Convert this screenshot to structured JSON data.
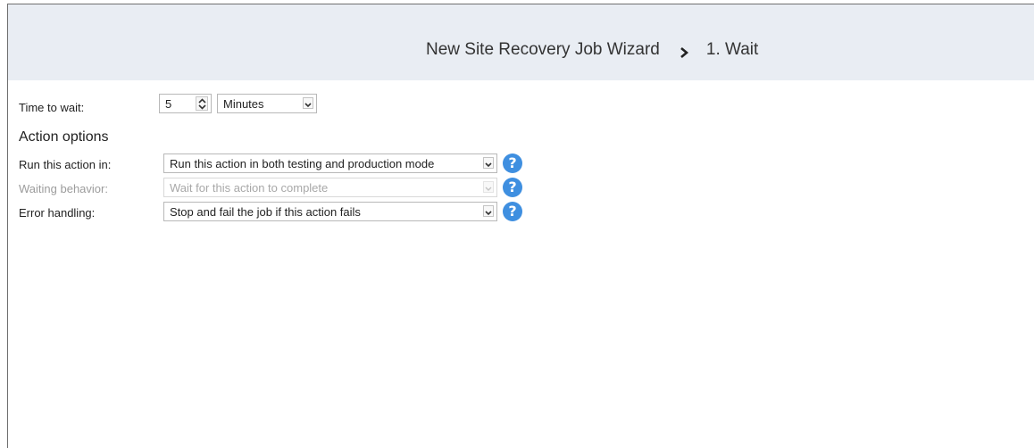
{
  "header": {
    "wizard_title": "New Site Recovery Job Wizard",
    "step": "1. Wait"
  },
  "time_to_wait": {
    "label": "Time to wait:",
    "value": "5",
    "unit": "Minutes"
  },
  "action_options": {
    "title": "Action options",
    "run_in": {
      "label": "Run this action in:",
      "value": "Run this action in both testing and production mode"
    },
    "waiting_behavior": {
      "label": "Waiting behavior:",
      "value": "Wait for this action to complete",
      "disabled": true
    },
    "error_handling": {
      "label": "Error handling:",
      "value": "Stop and fail the job if this action fails"
    },
    "help_glyph": "?"
  },
  "icons": {
    "breadcrumb_separator": "chevron-right-icon",
    "dropdown": "chevron-down-icon",
    "help": "help-icon"
  },
  "colors": {
    "header_bg": "#e9edf3",
    "help_icon": "#3f8fe0",
    "disabled_text": "#9c9c9c"
  }
}
